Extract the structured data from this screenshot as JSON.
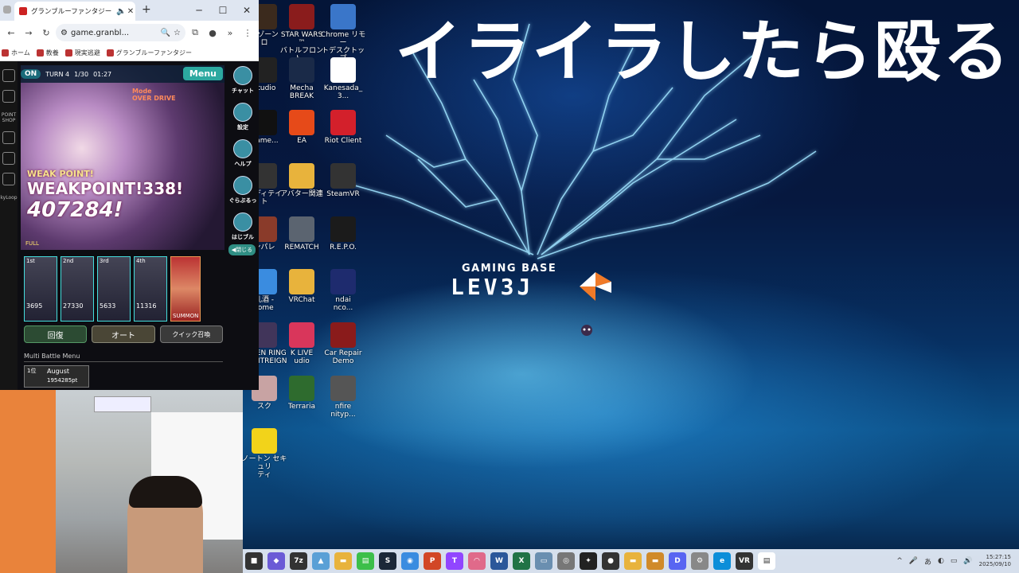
{
  "overlay": {
    "text": "イライラしたら殴る"
  },
  "wallpaper": {
    "logo_caption": "GAMING BASE",
    "logo_word": "LEV3J"
  },
  "desktop_icons": [
    {
      "label": "スゾーン\nロ",
      "color": "#3b2a1d"
    },
    {
      "label": "STAR WARS™\nバトルフロント...",
      "color": "#8a1c1c"
    },
    {
      "label": "Chrome リモー\nトデスクトップ",
      "color": "#3a76c9"
    },
    {
      "label": "Studio",
      "color": "#222"
    },
    {
      "label": "Mecha\nBREAK",
      "color": "#1a2a48"
    },
    {
      "label": "Kanesada_3...",
      "color": "#ffffff"
    },
    {
      "label": "Game...",
      "color": "#111"
    },
    {
      "label": "EA",
      "color": "#e64a19"
    },
    {
      "label": "Riot Client",
      "color": "#d3202b"
    },
    {
      "label": "イディテイ\nト",
      "color": "#333"
    },
    {
      "label": "アバター関連",
      "color": "#e8b33c"
    },
    {
      "label": "SteamVR",
      "color": "#333"
    },
    {
      "label": "ンパレ",
      "color": "#8a3b2a"
    },
    {
      "label": "REMATCH",
      "color": "#5b6470"
    },
    {
      "label": "R.E.P.O.",
      "color": "#1b1b1b"
    },
    {
      "label": "乳酒 -\nrome",
      "color": "#3a8ce0"
    },
    {
      "label": "VRChat",
      "color": "#e8b33c"
    },
    {
      "label": "ndai\nnco...",
      "color": "#1e2b6e"
    },
    {
      "label": "ELDEN RING\nNIGHTREIGN",
      "color": "#41355a"
    },
    {
      "label": "K LIVE\nudio",
      "color": "#d9365b"
    },
    {
      "label": "Car Repair\nDemo",
      "color": "#8a1b1b"
    },
    {
      "label": "スク",
      "color": "#c8a3a3"
    },
    {
      "label": "Terraria",
      "color": "#2e6b2e"
    },
    {
      "label": "nfire\nnityp...",
      "color": "#555"
    },
    {
      "label": "ノートン セキュリ\nティ",
      "color": "#f2d31a"
    }
  ],
  "browser": {
    "tab_title": "グランブルーファンタジー",
    "url": "game.granbl...",
    "new_tab": "+",
    "minimize": "─",
    "maximize": "☐",
    "close": "✕",
    "bookmarks": [
      "ホーム",
      "教養",
      "現実逃避",
      "グランブルーファンタジー"
    ]
  },
  "game": {
    "sound": "ON",
    "turn": "TURN 4",
    "count": "1/30",
    "time": "01:27",
    "menu": "Menu",
    "mode_label": "Mode",
    "overdrive": "OVER DRIVE",
    "weak1": "WEAK POINT!",
    "dmg1": "WEAKPOINT!338!",
    "dmg2": "407284!",
    "full": "FULL",
    "side_buttons": [
      "チャット",
      "設定",
      "ヘルプ",
      "ぐらぶるっ",
      "はじブル"
    ],
    "close_label": "◀閉じる",
    "chars": [
      {
        "label": "1st",
        "hp": "3695"
      },
      {
        "label": "2nd",
        "hp": "27330"
      },
      {
        "label": "3rd",
        "hp": "5633"
      },
      {
        "label": "4th",
        "hp": "11316"
      }
    ],
    "summon": "SUMMON",
    "actions": {
      "heal": "回復",
      "auto": "オート",
      "quick": "クイック召喚"
    },
    "multi_title": "Multi Battle Menu",
    "multi_entry": {
      "rank": "1位",
      "name": "August",
      "points": "1954285pt"
    }
  },
  "left_rail": [
    "POINT SHOP",
    "kyLoop"
  ],
  "taskbar": {
    "time": "15:27:15",
    "date": "2025/09/10",
    "ime": "あ"
  }
}
